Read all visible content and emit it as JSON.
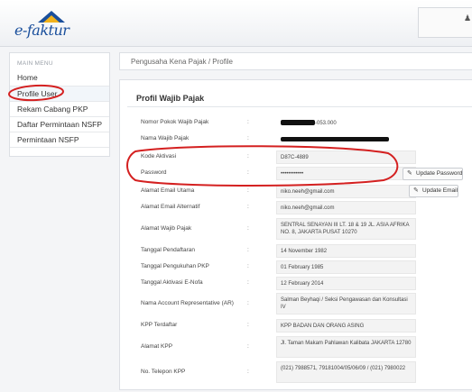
{
  "header": {
    "logo_text": "e-faktur",
    "user_icon": "user-icon",
    "user_glyph": "♟"
  },
  "sidebar": {
    "heading": "MAIN MENU",
    "items": [
      {
        "label": "Home"
      },
      {
        "label": "Profile User"
      },
      {
        "label": "Rekam Cabang PKP"
      },
      {
        "label": "Daftar Permintaan NSFP"
      },
      {
        "label": "Permintaan NSFP"
      }
    ]
  },
  "breadcrumb": "Pengusaha Kena Pajak / Profile",
  "profile": {
    "title": "Profil Wajib Pajak",
    "fields": [
      {
        "label": "Nomor Pokok Wajib Pajak",
        "value": "-053.000"
      },
      {
        "label": "Nama Wajib Pajak",
        "value": ""
      },
      {
        "label": "Kode Aktivasi",
        "value": "D87C-4889"
      },
      {
        "label": "Password",
        "value": "••••••••••••"
      },
      {
        "label": "Alamat Email Utama",
        "value": "niko.neeh@gmail.com"
      },
      {
        "label": "Alamat Email Alternatif",
        "value": "niko.neeh@gmail.com"
      },
      {
        "label": "Alamat Wajib Pajak",
        "value": "SENTRAL SENAYAN III LT. 18 & 19 JL. ASIA AFRIKA NO. 8, JAKARTA PUSAT 10270"
      },
      {
        "label": "Tanggal Pendaftaran",
        "value": "14 November 1982"
      },
      {
        "label": "Tanggal Pengukuhan PKP",
        "value": "01 February 1985"
      },
      {
        "label": "Tanggal Aktivasi E-Nofa",
        "value": "12 February 2014"
      },
      {
        "label": "Nama Account Representative (AR)",
        "value": "Salman Beyhaqi / Seksi Pengawasan dan Konsultasi IV"
      },
      {
        "label": "KPP Terdaftar",
        "value": "KPP BADAN DAN ORANG ASING"
      },
      {
        "label": "Alamat KPP",
        "value": "Jl. Taman Makam Pahlawan Kalibata JAKARTA 12780"
      },
      {
        "label": "No. Telepon KPP",
        "value": "(021) 7988571, 79181004/05/06/09 / (021) 7980022"
      }
    ],
    "colon": ":",
    "buttons": {
      "update_password": "Update Password",
      "update_email": "Update Email",
      "pencil_glyph": "✎"
    }
  },
  "colors": {
    "annotation_red": "#d42020",
    "logo_blue": "#1a4f9c",
    "logo_yellow": "#f2b21b"
  }
}
